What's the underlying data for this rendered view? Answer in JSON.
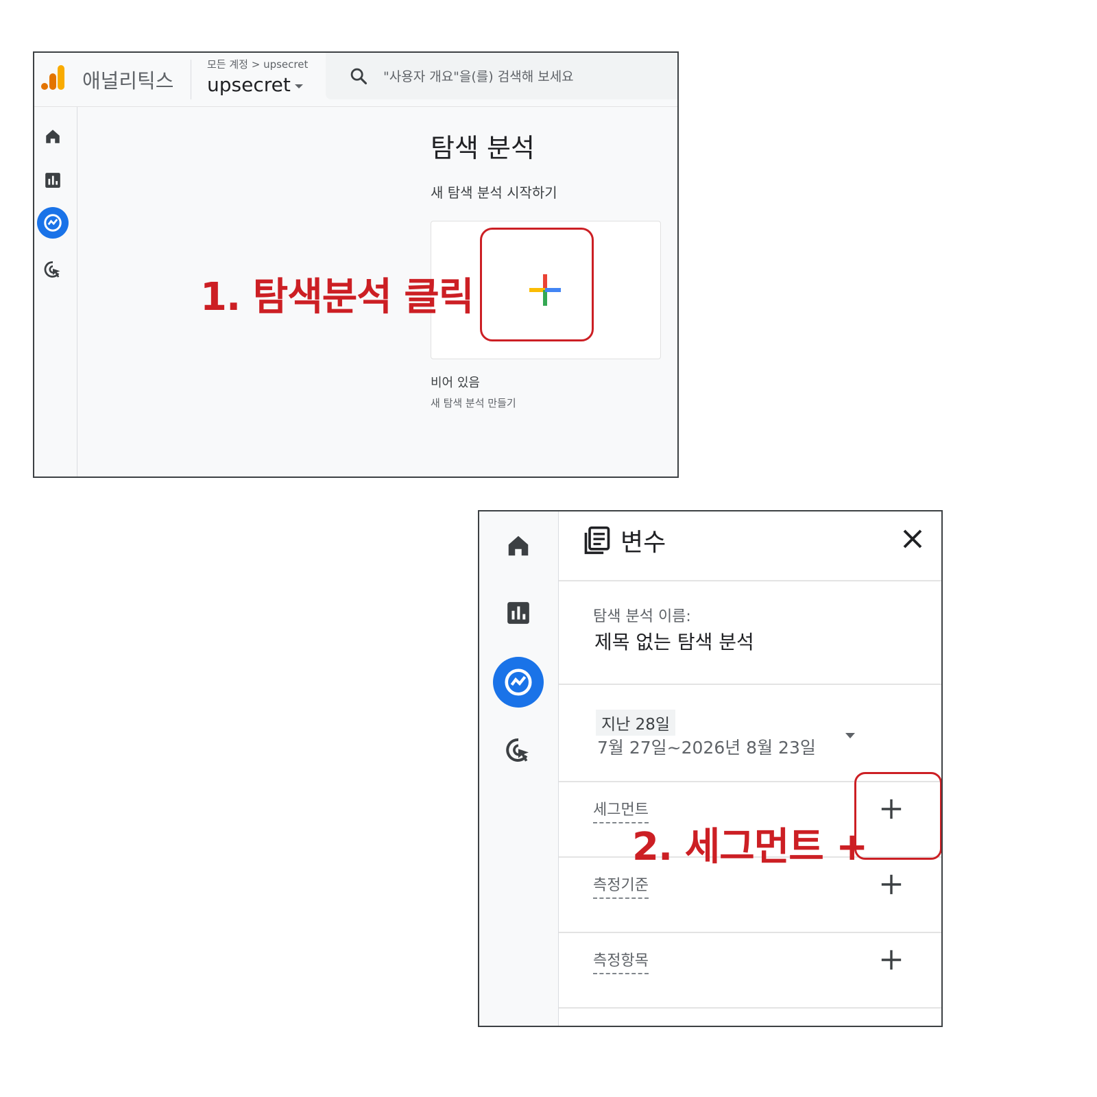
{
  "panel1": {
    "brand": "애널리틱스",
    "breadcrumb": "모든 계정 > upsecret",
    "account_name": "upsecret",
    "search_placeholder": "\"사용자 개요\"을(를) 검색해 보세요",
    "page_title": "탐색 분석",
    "start_new_label": "새 탐색 분석 시작하기",
    "empty_title": "비어 있음",
    "empty_subtitle": "새 탐색 분석 만들기",
    "annotation": "1. 탐색분석 클릭",
    "nav_icons": [
      "home-icon",
      "reports-icon",
      "explore-icon",
      "advertising-icon"
    ],
    "active_nav": "explore-icon"
  },
  "panel2": {
    "title": "변수",
    "exploration_name_label": "탐색 분석 이름:",
    "exploration_name_value": "제목 없는 탐색 분석",
    "date_chip": "지난 28일",
    "date_range": "7월 27일~2026년 8월 23일",
    "sections": [
      {
        "label": "세그먼트"
      },
      {
        "label": "측정기준"
      },
      {
        "label": "측정항목"
      }
    ],
    "annotation": "2. 세그먼트 +",
    "nav_icons": [
      "home-icon",
      "reports-icon",
      "explore-icon",
      "advertising-icon"
    ],
    "active_nav": "explore-icon"
  },
  "colors": {
    "annotation_red": "#cc1f24",
    "active_blue": "#1a73e8",
    "plus_blue": "#4285f4",
    "plus_red": "#ea4335",
    "plus_yellow": "#fbbc04",
    "plus_green": "#34a853"
  }
}
